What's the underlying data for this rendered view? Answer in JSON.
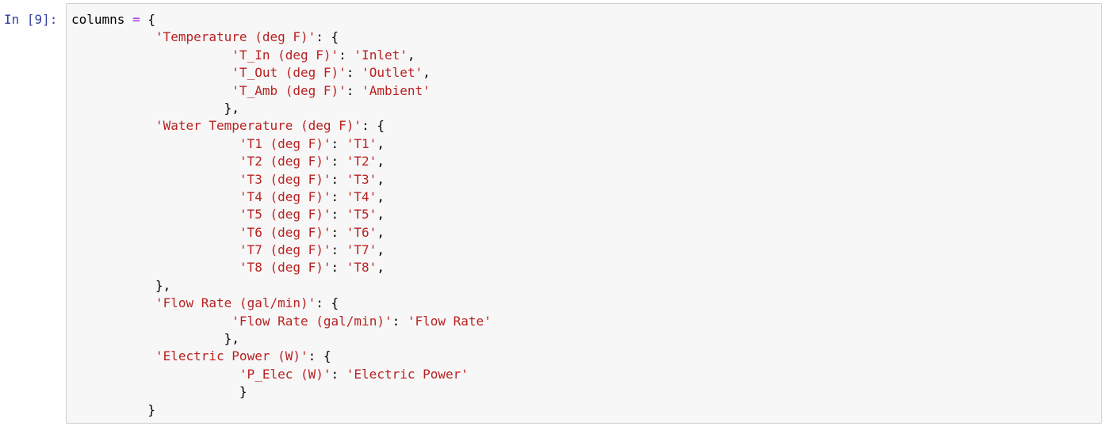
{
  "cell": {
    "prompt": "In [9]:",
    "language": "python",
    "colors": {
      "prompt": "#303f9f",
      "string": "#ba2121",
      "operator": "#aa22ff",
      "text": "#000000",
      "cell_background": "#f7f7f7",
      "cell_border": "#cfcfcf"
    },
    "lines": [
      [
        {
          "t": "var",
          "v": "columns"
        },
        {
          "t": "punct",
          "v": " "
        },
        {
          "t": "op",
          "v": "="
        },
        {
          "t": "punct",
          "v": " {"
        }
      ],
      [
        {
          "t": "punct",
          "v": "           "
        },
        {
          "t": "str",
          "v": "'Temperature (deg F)'"
        },
        {
          "t": "punct",
          "v": ": {"
        }
      ],
      [
        {
          "t": "punct",
          "v": "                     "
        },
        {
          "t": "str",
          "v": "'T_In (deg F)'"
        },
        {
          "t": "punct",
          "v": ": "
        },
        {
          "t": "str",
          "v": "'Inlet'"
        },
        {
          "t": "punct",
          "v": ","
        }
      ],
      [
        {
          "t": "punct",
          "v": "                     "
        },
        {
          "t": "str",
          "v": "'T_Out (deg F)'"
        },
        {
          "t": "punct",
          "v": ": "
        },
        {
          "t": "str",
          "v": "'Outlet'"
        },
        {
          "t": "punct",
          "v": ","
        }
      ],
      [
        {
          "t": "punct",
          "v": "                     "
        },
        {
          "t": "str",
          "v": "'T_Amb (deg F)'"
        },
        {
          "t": "punct",
          "v": ": "
        },
        {
          "t": "str",
          "v": "'Ambient'"
        }
      ],
      [
        {
          "t": "punct",
          "v": "                    },"
        }
      ],
      [
        {
          "t": "punct",
          "v": "           "
        },
        {
          "t": "str",
          "v": "'Water Temperature (deg F)'"
        },
        {
          "t": "punct",
          "v": ": {"
        }
      ],
      [
        {
          "t": "punct",
          "v": "                      "
        },
        {
          "t": "str",
          "v": "'T1 (deg F)'"
        },
        {
          "t": "punct",
          "v": ": "
        },
        {
          "t": "str",
          "v": "'T1'"
        },
        {
          "t": "punct",
          "v": ","
        }
      ],
      [
        {
          "t": "punct",
          "v": "                      "
        },
        {
          "t": "str",
          "v": "'T2 (deg F)'"
        },
        {
          "t": "punct",
          "v": ": "
        },
        {
          "t": "str",
          "v": "'T2'"
        },
        {
          "t": "punct",
          "v": ","
        }
      ],
      [
        {
          "t": "punct",
          "v": "                      "
        },
        {
          "t": "str",
          "v": "'T3 (deg F)'"
        },
        {
          "t": "punct",
          "v": ": "
        },
        {
          "t": "str",
          "v": "'T3'"
        },
        {
          "t": "punct",
          "v": ","
        }
      ],
      [
        {
          "t": "punct",
          "v": "                      "
        },
        {
          "t": "str",
          "v": "'T4 (deg F)'"
        },
        {
          "t": "punct",
          "v": ": "
        },
        {
          "t": "str",
          "v": "'T4'"
        },
        {
          "t": "punct",
          "v": ","
        }
      ],
      [
        {
          "t": "punct",
          "v": "                      "
        },
        {
          "t": "str",
          "v": "'T5 (deg F)'"
        },
        {
          "t": "punct",
          "v": ": "
        },
        {
          "t": "str",
          "v": "'T5'"
        },
        {
          "t": "punct",
          "v": ","
        }
      ],
      [
        {
          "t": "punct",
          "v": "                      "
        },
        {
          "t": "str",
          "v": "'T6 (deg F)'"
        },
        {
          "t": "punct",
          "v": ": "
        },
        {
          "t": "str",
          "v": "'T6'"
        },
        {
          "t": "punct",
          "v": ","
        }
      ],
      [
        {
          "t": "punct",
          "v": "                      "
        },
        {
          "t": "str",
          "v": "'T7 (deg F)'"
        },
        {
          "t": "punct",
          "v": ": "
        },
        {
          "t": "str",
          "v": "'T7'"
        },
        {
          "t": "punct",
          "v": ","
        }
      ],
      [
        {
          "t": "punct",
          "v": "                      "
        },
        {
          "t": "str",
          "v": "'T8 (deg F)'"
        },
        {
          "t": "punct",
          "v": ": "
        },
        {
          "t": "str",
          "v": "'T8'"
        },
        {
          "t": "punct",
          "v": ","
        }
      ],
      [
        {
          "t": "punct",
          "v": "           },"
        }
      ],
      [
        {
          "t": "punct",
          "v": "           "
        },
        {
          "t": "str",
          "v": "'Flow Rate (gal/min)'"
        },
        {
          "t": "punct",
          "v": ": {"
        }
      ],
      [
        {
          "t": "punct",
          "v": "                     "
        },
        {
          "t": "str",
          "v": "'Flow Rate (gal/min)'"
        },
        {
          "t": "punct",
          "v": ": "
        },
        {
          "t": "str",
          "v": "'Flow Rate'"
        }
      ],
      [
        {
          "t": "punct",
          "v": "                    },"
        }
      ],
      [
        {
          "t": "punct",
          "v": "           "
        },
        {
          "t": "str",
          "v": "'Electric Power (W)'"
        },
        {
          "t": "punct",
          "v": ": {"
        }
      ],
      [
        {
          "t": "punct",
          "v": "                      "
        },
        {
          "t": "str",
          "v": "'P_Elec (W)'"
        },
        {
          "t": "punct",
          "v": ": "
        },
        {
          "t": "str",
          "v": "'Electric Power'"
        }
      ],
      [
        {
          "t": "punct",
          "v": "                      }"
        }
      ],
      [
        {
          "t": "punct",
          "v": "          }"
        }
      ]
    ]
  }
}
